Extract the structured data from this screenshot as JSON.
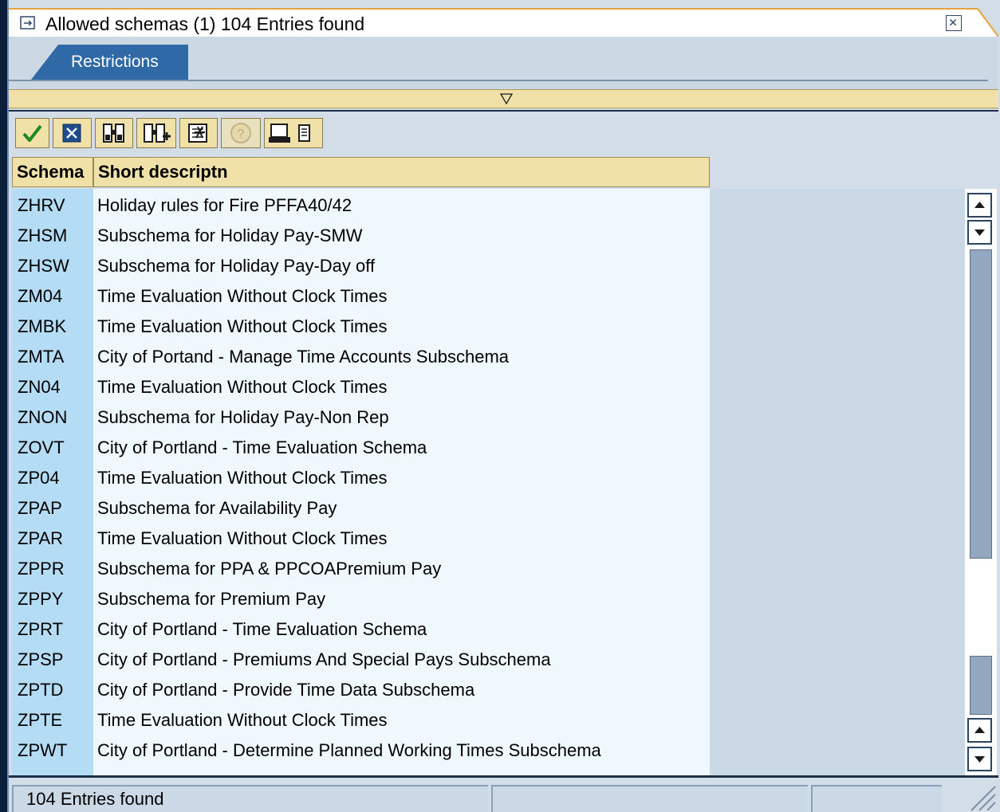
{
  "window": {
    "title": "Allowed schemas (1)  104 Entries found"
  },
  "restrictions_tab": {
    "label": "Restrictions"
  },
  "toolbar": {
    "buttons": [
      {
        "name": "confirm-button",
        "icon": "checkmark-icon"
      },
      {
        "name": "cancel-button",
        "icon": "cancel-x-icon"
      },
      {
        "name": "find-button",
        "icon": "binoculars-icon"
      },
      {
        "name": "find-next-button",
        "icon": "binoculars-plus-icon"
      },
      {
        "name": "new-list-button",
        "icon": "new-list-icon"
      },
      {
        "name": "help-button",
        "icon": "help-icon"
      },
      {
        "name": "print-button",
        "icon": "printer-icon"
      }
    ]
  },
  "table": {
    "columns": [
      "Schema",
      "Short descriptn"
    ],
    "rows": [
      {
        "schema": "ZHRV",
        "desc": "Holiday rules for Fire PFFA40/42"
      },
      {
        "schema": "ZHSM",
        "desc": "Subschema for Holiday Pay-SMW"
      },
      {
        "schema": "ZHSW",
        "desc": "Subschema for Holiday Pay-Day off"
      },
      {
        "schema": "ZM04",
        "desc": "Time Evaluation Without Clock Times"
      },
      {
        "schema": "ZMBK",
        "desc": "Time Evaluation Without Clock Times"
      },
      {
        "schema": "ZMTA",
        "desc": "City of Portand - Manage Time Accounts Subschema"
      },
      {
        "schema": "ZN04",
        "desc": "Time Evaluation Without Clock Times"
      },
      {
        "schema": "ZNON",
        "desc": "Subschema for Holiday Pay-Non Rep"
      },
      {
        "schema": "ZOVT",
        "desc": "City of Portland - Time Evaluation Schema"
      },
      {
        "schema": "ZP04",
        "desc": "Time Evaluation Without Clock Times"
      },
      {
        "schema": "ZPAP",
        "desc": "Subschema for Availability Pay"
      },
      {
        "schema": "ZPAR",
        "desc": "Time Evaluation Without Clock Times"
      },
      {
        "schema": "ZPPR",
        "desc": "Subschema for PPA & PPCOAPremium Pay"
      },
      {
        "schema": "ZPPY",
        "desc": "Subschema for Premium Pay"
      },
      {
        "schema": "ZPRT",
        "desc": "City of Portland - Time Evaluation Schema"
      },
      {
        "schema": "ZPSP",
        "desc": "City of Portland - Premiums And Special Pays Subschema"
      },
      {
        "schema": "ZPTD",
        "desc": "City of Portland - Provide Time Data Subschema"
      },
      {
        "schema": "ZPTE",
        "desc": "Time Evaluation Without Clock Times"
      },
      {
        "schema": "ZPWT",
        "desc": "City of Portland - Determine Planned Working Times Subschema"
      }
    ]
  },
  "statusbar": {
    "text": "104 Entries found"
  },
  "colors": {
    "header_bg": "#efe1a7",
    "key_column_bg": "#b4dcf5",
    "desc_column_bg": "#eef8fd",
    "tab_blue": "#2f6aa6",
    "accent_orange": "#e8a33a"
  }
}
